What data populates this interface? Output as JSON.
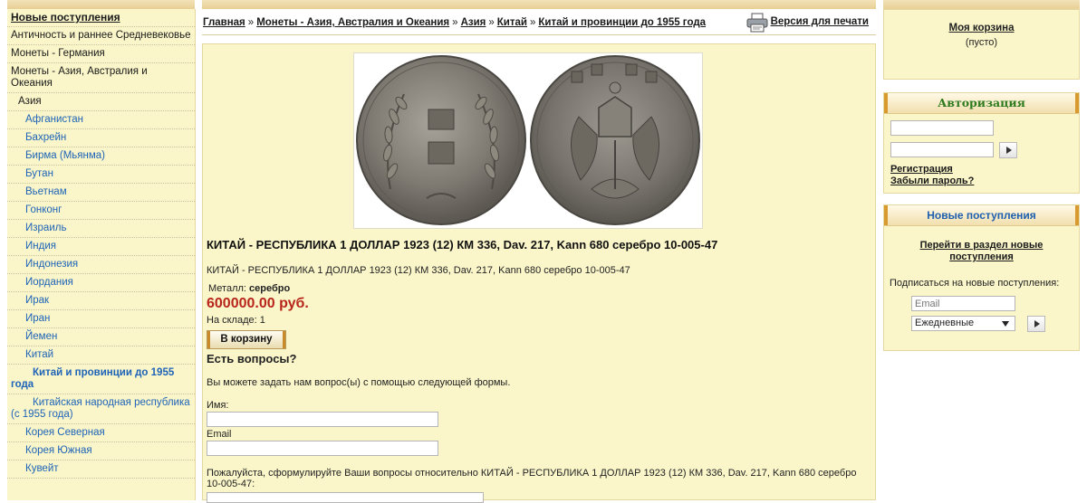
{
  "sidebar": {
    "items": [
      {
        "label": "Новые поступления"
      },
      {
        "label": "Античность и раннее Средневековье"
      },
      {
        "label": "Монеты - Германия"
      },
      {
        "label": "Монеты - Азия, Австралия и Океания"
      },
      {
        "label": "Азия"
      },
      {
        "label": "Афганистан"
      },
      {
        "label": "Бахрейн"
      },
      {
        "label": "Бирма (Мьянма)"
      },
      {
        "label": "Бутан"
      },
      {
        "label": "Вьетнам"
      },
      {
        "label": "Гонконг"
      },
      {
        "label": "Израиль"
      },
      {
        "label": "Индия"
      },
      {
        "label": "Индонезия"
      },
      {
        "label": "Иордания"
      },
      {
        "label": "Ирак"
      },
      {
        "label": "Иран"
      },
      {
        "label": "Йемен"
      },
      {
        "label": "Китай"
      },
      {
        "label": "Китай и провинции до 1955 года"
      },
      {
        "label": "Китайская народная республика (с 1955 года)"
      },
      {
        "label": "Корея Северная"
      },
      {
        "label": "Корея Южная"
      },
      {
        "label": "Кувейт"
      }
    ]
  },
  "breadcrumb": {
    "items": [
      "Главная",
      "Монеты - Азия, Австралия и Океания",
      "Азия",
      "Китай",
      "Китай и провинции до 1955 года"
    ],
    "separator": "»"
  },
  "print_label": "Версия для печати",
  "product": {
    "title": "КИТАЙ - РЕСПУБЛИКА 1 ДОЛЛАР 1923 (12) КМ 336, Dav. 217, Kann 680 серебро 10-005-47",
    "description": "КИТАЙ - РЕСПУБЛИКА 1 ДОЛЛАР 1923 (12)  КМ 336, Dav. 217, Kann 680 серебро  10-005-47",
    "metal_label": "Металл:",
    "metal_value": "серебро",
    "price": "600000.00 руб.",
    "stock": "На складе: 1",
    "cart_button": "В корзину"
  },
  "questions": {
    "title": "Есть вопросы?",
    "intro": "Вы можете задать нам вопрос(ы) с помощью следующей формы.",
    "name_label": "Имя:",
    "email_label": "Email",
    "prompt": "Пожалуйста, сформулируйте Ваши вопросы относительно КИТАЙ - РЕСПУБЛИКА 1 ДОЛЛАР 1923 (12) КМ 336, Dav. 217, Kann 680 серебро 10-005-47:"
  },
  "cart": {
    "title": "Моя корзина",
    "status": "(пусто)"
  },
  "auth": {
    "title": "Авторизация",
    "register": "Регистрация",
    "forgot": "Забыли пароль?"
  },
  "news": {
    "title": "Новые поступления",
    "link": "Перейти в раздел новые поступления",
    "subscribe": "Подписаться на новые поступления:",
    "email_placeholder": "Email",
    "frequency": "Ежедневные"
  },
  "colors": {
    "panel_bg": "#faf6c9",
    "price": "#b8251a",
    "link_blue": "#1e63b8",
    "auth_green": "#2e7a1f"
  }
}
